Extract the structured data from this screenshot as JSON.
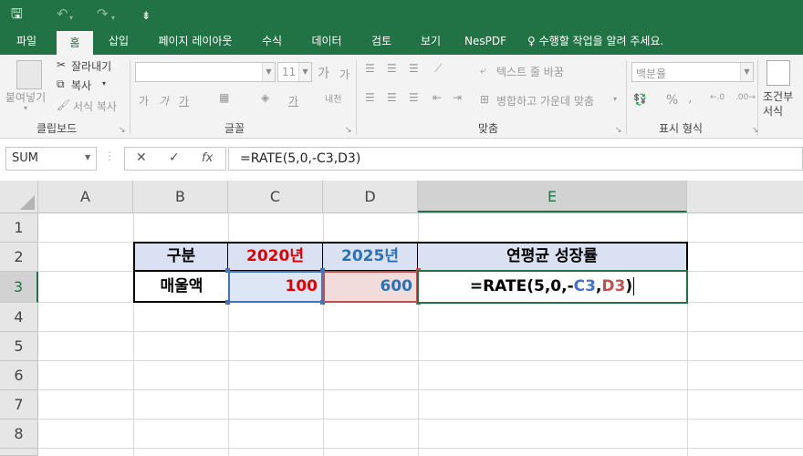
{
  "quick_access": {
    "save": "🖫",
    "undo": "↶",
    "redo": "↷",
    "customize": "⇟"
  },
  "tabs": [
    "파일",
    "홈",
    "삽입",
    "페이지 레이아웃",
    "수식",
    "데이터",
    "검토",
    "보기",
    "NesPDF"
  ],
  "tell_me": "수행할 작업을 알려 주세요.",
  "ribbon": {
    "clipboard": {
      "paste": "붙여넣기",
      "cut": "잘라내기",
      "copy": "복사",
      "format_painter": "서식 복사",
      "label": "클립보드"
    },
    "font": {
      "name": "",
      "size": "11",
      "grow": "가",
      "shrink": "가",
      "bold": "가",
      "italic": "가",
      "underline": "가",
      "label": "글꼴",
      "phonetic": "내천"
    },
    "alignment": {
      "wrap": "텍스트 줄 바꿈",
      "merge": "병합하고 가운데 맞춤",
      "label": "맞춤"
    },
    "number": {
      "format": "백분율",
      "percent": "%",
      "comma": ",",
      "label": "표시 형식"
    },
    "styles": {
      "conditional": "조건부 서식"
    }
  },
  "formula_bar": {
    "name_box": "SUM",
    "cancel": "✕",
    "enter": "✓",
    "fx": "fx",
    "formula": "=RATE(5,0,-C3,D3)"
  },
  "columns": [
    "A",
    "B",
    "C",
    "D",
    "E"
  ],
  "rows": [
    "1",
    "2",
    "3",
    "4",
    "5",
    "6",
    "7",
    "8"
  ],
  "table": {
    "header": {
      "category": "구분",
      "year1": "2020년",
      "year2": "2025년",
      "growth": "연평균 성장률"
    },
    "row": {
      "label": "매울액",
      "val1": "100",
      "val2": "600"
    },
    "edit": {
      "prefix": "=RATE(5,0,-",
      "ref1": "C3",
      "comma": ",",
      "ref2": "D3",
      "close": ")"
    }
  },
  "colors": {
    "excel_green": "#217346",
    "red": "#e00000",
    "blue": "#2a72b5",
    "ref_blue": "#4472c4",
    "ref_red": "#c0504d"
  }
}
